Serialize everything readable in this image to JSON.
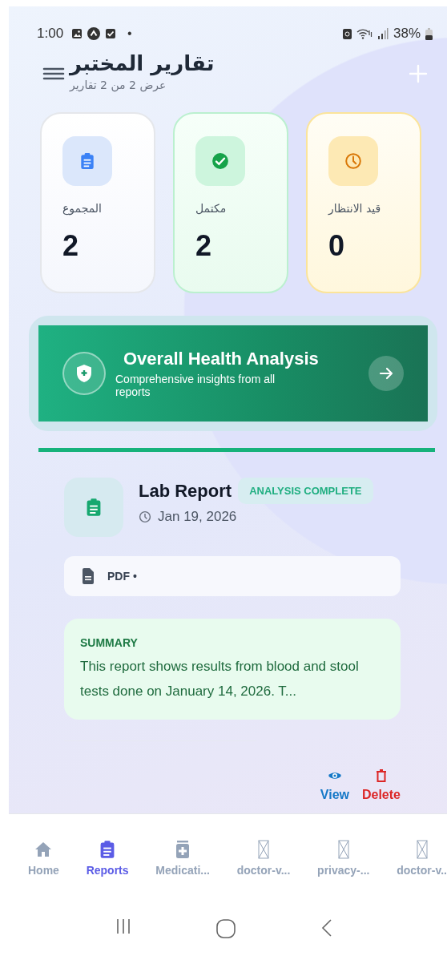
{
  "status_bar": {
    "time": "1:00",
    "dot": "•",
    "battery": "38%"
  },
  "header": {
    "title": "تقارير المختبر",
    "subtitle": "عرض 2 من 2 تقارير"
  },
  "stats": {
    "total": {
      "label": "المجموع",
      "value": "2"
    },
    "complete": {
      "label": "مكتمل",
      "value": "2"
    },
    "pending": {
      "label": "قيد الانتظار",
      "value": "0"
    }
  },
  "banner": {
    "title": "Overall Health Analysis",
    "subtitle": "Comprehensive insights from all reports"
  },
  "reports": [
    {
      "title": "Lab Report",
      "badge": "ANALYSIS COMPLETE",
      "date": "Jan 19, 2026",
      "file": "PDF •",
      "summary_label": "SUMMARY",
      "summary": "This report shows results from blood and stool tests done on January 14, 2026. T...",
      "actions": [
        {
          "kind": "view",
          "label": "View"
        },
        {
          "kind": "delete",
          "label": "Delete"
        }
      ]
    }
  ],
  "nav": [
    {
      "kind": "home",
      "label": "Home",
      "selected": false
    },
    {
      "kind": "reports",
      "label": "Reports",
      "selected": true
    },
    {
      "kind": "medications",
      "label": "Medicati...",
      "selected": false
    },
    {
      "kind": "broken",
      "label": "doctor-v...",
      "selected": false
    },
    {
      "kind": "broken",
      "label": "privacy-...",
      "selected": false
    },
    {
      "kind": "broken",
      "label": "doctor-v..",
      "selected": false
    }
  ]
}
